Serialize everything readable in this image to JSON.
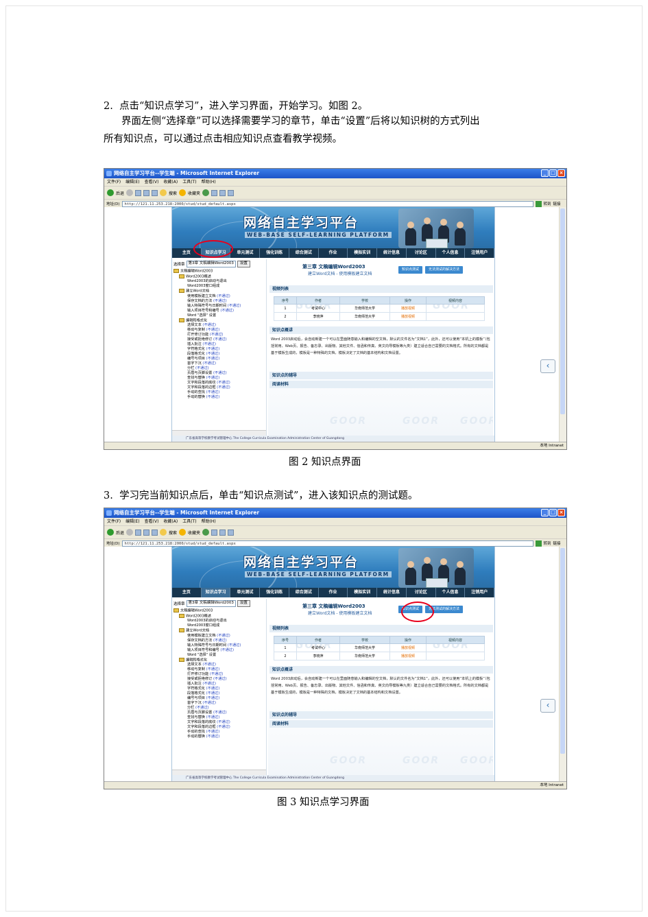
{
  "doc": {
    "step2_num": "2.",
    "step2_text": "点击“知识点学习”，进入学习界面，开始学习。如图 2。",
    "desc_line1": "界面左侧“选择章”可以选择需要学习的章节，单击“设置”后将以知识树的方式列出",
    "desc_line2": "所有知识点，可以通过点击相应知识点查看教学视频。",
    "fig2_caption": "图 2  知识点界面",
    "step3_num": "3.",
    "step3_text": "学习完当前知识点后，单击“知识点测试”，进入该知识点的测试题。",
    "fig3_caption": "图 3  知识点学习界面"
  },
  "browser": {
    "title": "网络自主学习平台--学生端 - Microsoft Internet Explorer",
    "menu": [
      "文件(F)",
      "编辑(E)",
      "查看(V)",
      "收藏(A)",
      "工具(T)",
      "帮助(H)"
    ],
    "back": "后退",
    "search": "搜索",
    "favorites": "收藏夹",
    "address_label": "地址(D)",
    "address": "http://121.11.253.218:2000/stud/stud_default.aspx",
    "go": "转到",
    "links": "链接",
    "status_zone": "本地 Intranet"
  },
  "site": {
    "title": "网络自主学习平台",
    "subtitle": "WEB-BASE SELF-LEARNING PLATFORM",
    "nav": [
      "主页",
      "知识点学习",
      "单元测试",
      "强化训练",
      "综合测试",
      "作业",
      "模拟实训",
      "统计信息",
      "讨论区",
      "个人信息",
      "注销用户"
    ],
    "chapter_label": "选择章",
    "chapter_value": "第3章 文稿编辑Word2003",
    "setup_btn": "设置",
    "tree": [
      {
        "level": 0,
        "text": "文稿编辑Word2003",
        "folder": true
      },
      {
        "level": 1,
        "text": "Word2003概述",
        "folder": true
      },
      {
        "level": 2,
        "text": "Word2003的启动与退出"
      },
      {
        "level": 2,
        "text": "Word2003窗口组成"
      },
      {
        "level": 1,
        "text": "建立Word文档",
        "folder": true
      },
      {
        "level": 2,
        "text": "使用模板建立文档",
        "status": "(不通过)"
      },
      {
        "level": 2,
        "text": "保存文档的方法",
        "status": "(不通过)"
      },
      {
        "level": 2,
        "text": "输入特殊符号与日期时间",
        "status": "(不通过)"
      },
      {
        "level": 2,
        "text": "输入项目符号和编号",
        "status": "(不通过)"
      },
      {
        "level": 2,
        "text": "Word \"选择\" 设置"
      },
      {
        "level": 1,
        "text": "编辑和格式化",
        "folder": true
      },
      {
        "level": 2,
        "text": "选择文本",
        "status": "(不通过)"
      },
      {
        "level": 2,
        "text": "移动与复制",
        "status": "(不通过)"
      },
      {
        "level": 2,
        "text": "打开修订功能",
        "status": "(不通过)"
      },
      {
        "level": 2,
        "text": "接受或拒绝修订",
        "status": "(不通过)"
      },
      {
        "level": 2,
        "text": "插入批注",
        "status": "(不通过)"
      },
      {
        "level": 2,
        "text": "字符格式化",
        "status": "(不通过)"
      },
      {
        "level": 2,
        "text": "段落格式化",
        "status": "(不通过)"
      },
      {
        "level": 2,
        "text": "编号与项目",
        "status": "(不通过)"
      },
      {
        "level": 2,
        "text": "首字下沉",
        "status": "(不通过)"
      },
      {
        "level": 2,
        "text": "分栏",
        "status": "(不通过)"
      },
      {
        "level": 2,
        "text": "页眉与页脚设置",
        "status": "(不通过)"
      },
      {
        "level": 2,
        "text": "查找与替换",
        "status": "(不通过)"
      },
      {
        "level": 2,
        "text": "文字和段落的底纹",
        "status": "(不通过)"
      },
      {
        "level": 2,
        "text": "文字和段落的边框",
        "status": "(不通过)"
      },
      {
        "level": 2,
        "text": "手动的查找",
        "status": "(不通过)"
      },
      {
        "level": 2,
        "text": "手动的替换",
        "status": "(不通过)"
      }
    ],
    "chapter_title": "第三章 文稿编辑Word2003",
    "chapter_sub": "建立Word文档 - 使用模板建立文档",
    "btn_test": "知识点测试",
    "btn_solution": "无法测试的解决方法",
    "video_list_head": "视频列表",
    "table_headers": [
      "序号",
      "作者",
      "学校",
      "操作",
      "视频内容"
    ],
    "table_rows": [
      [
        "1",
        "考试中心",
        "华南师范大学",
        "播放视频",
        ""
      ],
      [
        "2",
        "李晓萍",
        "华南师范大学",
        "播放视频",
        ""
      ]
    ],
    "kp_head": "知识点概讲",
    "kp_text": "Word 2003启动后，会自动新建一个可以在里面随意输入和编辑的空文档，默认的文件名为“文档1”，此外，还可以使用“本机上的模板”（包括常用、Web页、报告、备忘录、出版物、其他文件、信函和传真、英文向导模板等九类）建立适合自己需要的文档格式。所有的文档都是基于模板生成的，模板是一种特殊的文档，模板决定了文档的基本结构和文档设置。",
    "kp_help_head": "知识点的辅导",
    "material_head": "阅读材料",
    "watermark": "GOOR",
    "footer": "广东省高等学校教学考试管理中心  The College Curricula Examination Administration Center of Guangdong"
  }
}
